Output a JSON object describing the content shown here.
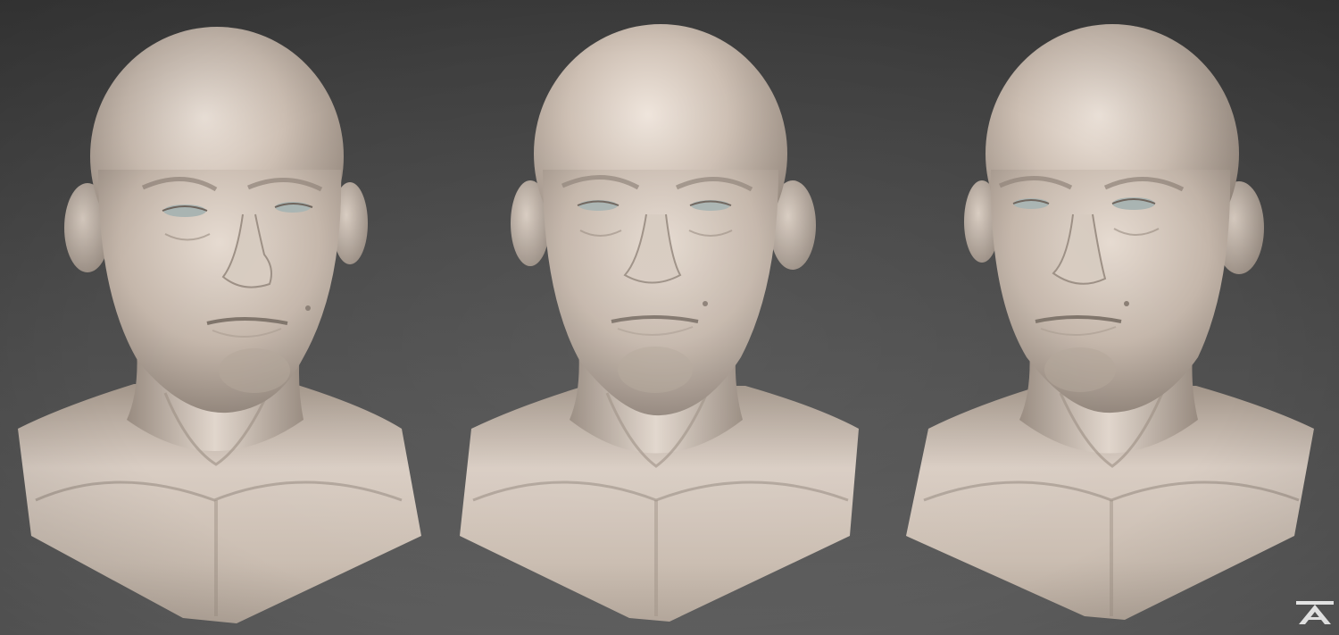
{
  "scene": {
    "background_color": "#4a4a4a",
    "sculpt_color": "#cdbfb3",
    "eye_color": "#a9b4b2"
  },
  "busts": [
    {
      "view": "three-quarter-left"
    },
    {
      "view": "front"
    },
    {
      "view": "three-quarter-right"
    }
  ],
  "logo": {
    "icon": "studio-logo-icon"
  }
}
